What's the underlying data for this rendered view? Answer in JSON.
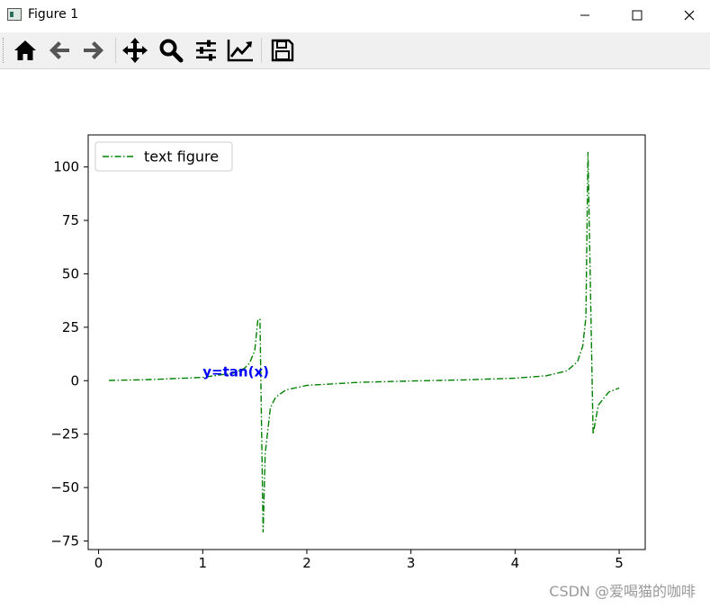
{
  "window": {
    "title": "Figure 1",
    "minimize_icon": "minimize-icon",
    "maximize_icon": "maximize-icon",
    "close_icon": "close-icon"
  },
  "toolbar": {
    "buttons": [
      {
        "name": "home",
        "icon": "home-icon"
      },
      {
        "name": "back",
        "icon": "arrow-left-icon"
      },
      {
        "name": "forward",
        "icon": "arrow-right-icon"
      },
      {
        "name": "pan",
        "icon": "move-icon"
      },
      {
        "name": "zoom",
        "icon": "magnifier-icon"
      },
      {
        "name": "configure-subplots",
        "icon": "sliders-icon"
      },
      {
        "name": "edit-axis",
        "icon": "chart-line-icon"
      },
      {
        "name": "save",
        "icon": "floppy-disk-icon"
      }
    ]
  },
  "chart_data": {
    "type": "line",
    "title": "",
    "xlabel": "",
    "ylabel": "",
    "xlim": [
      -0.1,
      5.25
    ],
    "ylim": [
      -79,
      115
    ],
    "xticks": [
      0,
      1,
      2,
      3,
      4,
      5
    ],
    "yticks": [
      -75,
      -50,
      -25,
      0,
      25,
      50,
      75,
      100
    ],
    "xtick_labels": [
      "0",
      "1",
      "2",
      "3",
      "4",
      "5"
    ],
    "ytick_labels": [
      "−75",
      "−50",
      "−25",
      "0",
      "25",
      "50",
      "75",
      "100"
    ],
    "legend": {
      "position": "upper-left",
      "entries": [
        "text figure"
      ]
    },
    "annotation": {
      "text": "y=tan(x)",
      "x": 1.0,
      "y": 2,
      "color": "#0000ff",
      "bold": true
    },
    "series": [
      {
        "name": "text figure",
        "color": "#008000",
        "linestyle": "dashdot",
        "x": [
          0.1,
          0.5,
          1.0,
          1.3,
          1.4,
          1.45,
          1.5,
          1.53,
          1.55,
          1.58,
          1.6,
          1.65,
          1.7,
          1.8,
          2.0,
          2.5,
          3.0,
          3.5,
          4.0,
          4.3,
          4.5,
          4.6,
          4.65,
          4.68,
          4.7,
          4.75,
          4.8,
          4.9,
          5.0
        ],
        "y": [
          0.1,
          0.55,
          1.56,
          3.6,
          5.8,
          8.2,
          14.1,
          28.7,
          28.7,
          -71,
          -34,
          -12.6,
          -7.7,
          -4.3,
          -2.2,
          -0.75,
          -0.14,
          0.37,
          1.16,
          2.3,
          4.6,
          8.9,
          16.2,
          29.7,
          107,
          -25,
          -11.4,
          -5.3,
          -3.4
        ]
      }
    ]
  },
  "watermark": "CSDN @爱喝猫的咖啡"
}
